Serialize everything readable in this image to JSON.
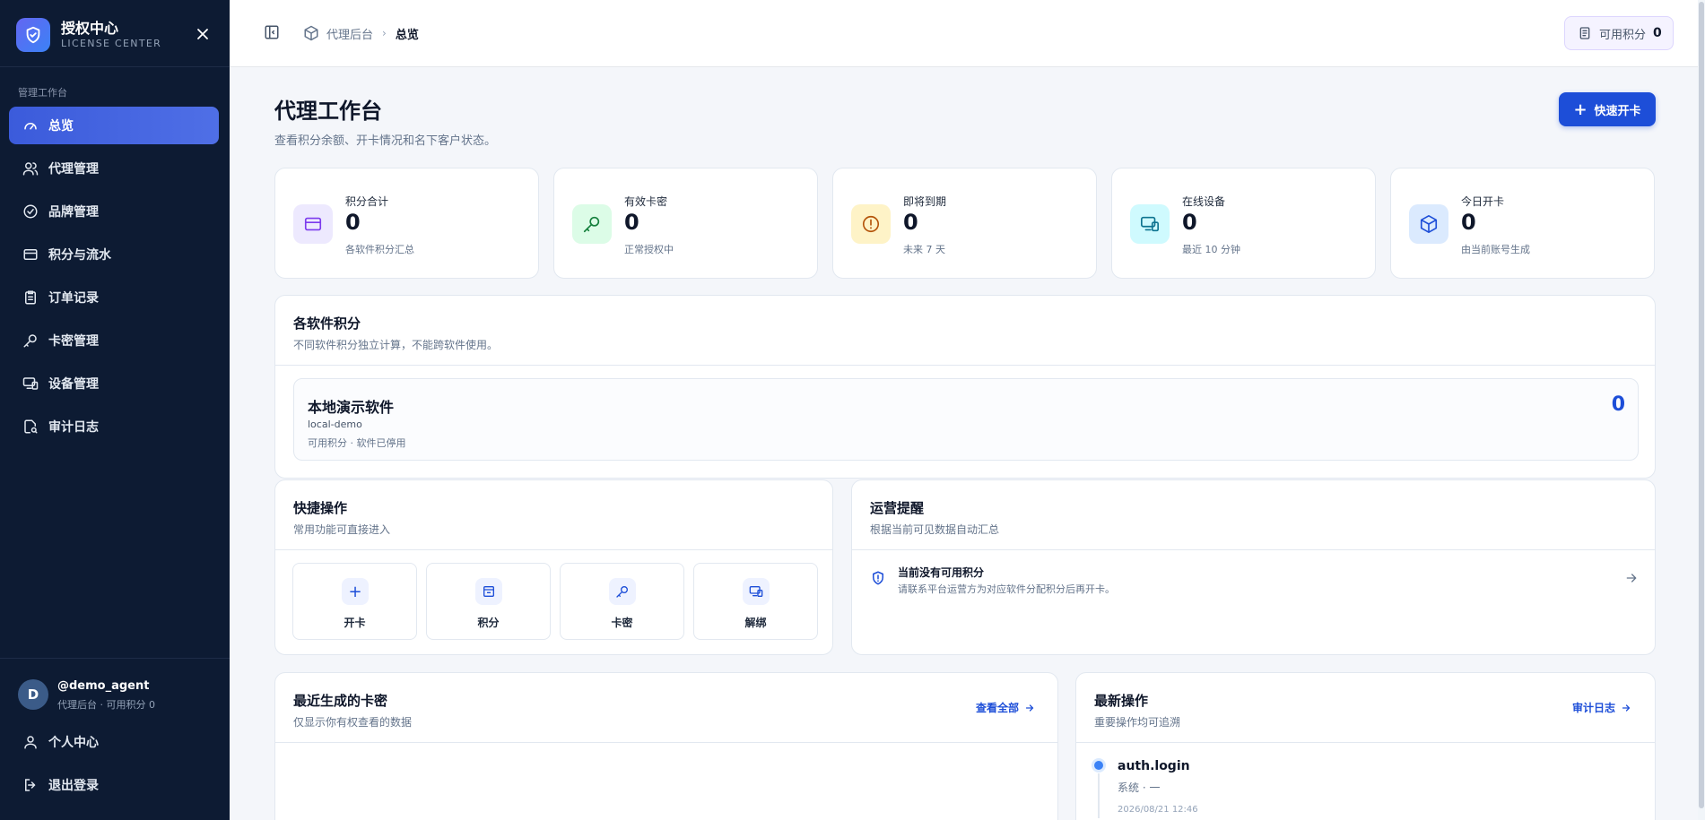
{
  "brand": {
    "title": "授权中心",
    "subtitle": "LICENSE CENTER"
  },
  "sidebar": {
    "section_label": "管理工作台",
    "items": [
      {
        "label": "总览",
        "icon": "gauge-icon"
      },
      {
        "label": "代理管理",
        "icon": "users-icon"
      },
      {
        "label": "品牌管理",
        "icon": "check-circle-icon"
      },
      {
        "label": "积分与流水",
        "icon": "credit-card-icon"
      },
      {
        "label": "订单记录",
        "icon": "clipboard-icon"
      },
      {
        "label": "卡密管理",
        "icon": "key-icon"
      },
      {
        "label": "设备管理",
        "icon": "devices-icon"
      },
      {
        "label": "审计日志",
        "icon": "audit-icon"
      }
    ],
    "user": {
      "avatar": "D",
      "name": "@demo_agent",
      "meta": "代理后台 · 可用积分 0"
    },
    "profile_label": "个人中心",
    "logout_label": "退出登录"
  },
  "topbar": {
    "breadcrumb_parent": "代理后台",
    "breadcrumb_separator": "›",
    "breadcrumb_current": "总览",
    "points_label": "可用积分",
    "points_value": "0"
  },
  "page": {
    "title": "代理工作台",
    "subtitle": "查看积分余额、开卡情况和名下客户状态。",
    "quick_open_label": "快速开卡",
    "quick_open_plus": "+"
  },
  "stats": [
    {
      "label": "积分合计",
      "value": "0",
      "hint": "各软件积分汇总"
    },
    {
      "label": "有效卡密",
      "value": "0",
      "hint": "正常授权中"
    },
    {
      "label": "即将到期",
      "value": "0",
      "hint": "未来 7 天"
    },
    {
      "label": "在线设备",
      "value": "0",
      "hint": "最近 10 分钟"
    },
    {
      "label": "今日开卡",
      "value": "0",
      "hint": "由当前账号生成"
    }
  ],
  "software_points": {
    "title": "各软件积分",
    "subtitle": "不同软件积分独立计算，不能跨软件使用。",
    "item": {
      "name": "本地演示软件",
      "key": "local-demo",
      "meta": "可用积分 · 软件已停用",
      "value": "0"
    }
  },
  "quick_actions": {
    "title": "快捷操作",
    "subtitle": "常用功能可直接进入",
    "tiles": [
      "开卡",
      "积分",
      "卡密",
      "解绑"
    ],
    "tile0_glyph": "+"
  },
  "ops_notice": {
    "title": "运营提醒",
    "subtitle": "根据当前可见数据自动汇总",
    "notice_title": "当前没有可用积分",
    "notice_desc": "请联系平台运营方为对应软件分配积分后再开卡。"
  },
  "recent_cards": {
    "title": "最近生成的卡密",
    "subtitle": "仅显示你有权查看的数据",
    "link": "查看全部"
  },
  "latest_ops": {
    "title": "最新操作",
    "subtitle": "重要操作均可追溯",
    "link": "审计日志",
    "entry": {
      "action": "auth.login",
      "meta": "系统 · 一",
      "time": "2026/08/21 12:46"
    }
  },
  "colors": {
    "sidebar_bg": "#0d1b33",
    "accent": "#1d4ed8",
    "active_nav": "#3b5bdb"
  }
}
